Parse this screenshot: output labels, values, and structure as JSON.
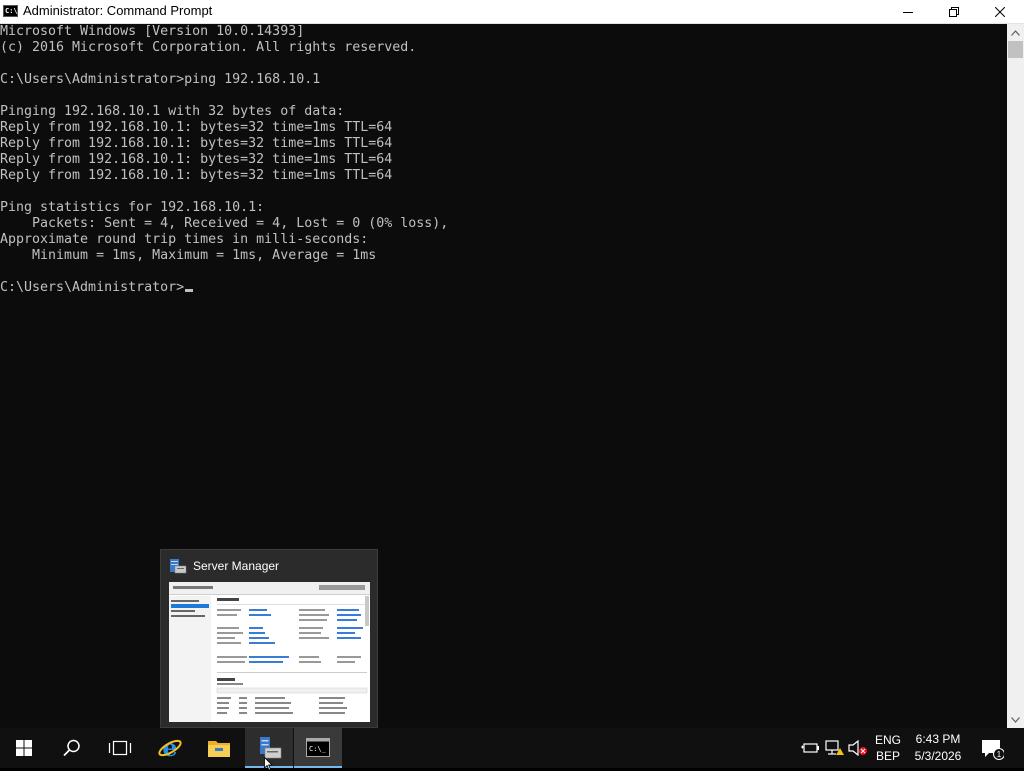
{
  "window": {
    "title": "Administrator: Command Prompt",
    "icon": "cmd-icon"
  },
  "console": {
    "lines": [
      "Microsoft Windows [Version 10.0.14393]",
      "(c) 2016 Microsoft Corporation. All rights reserved.",
      "",
      "C:\\Users\\Administrator>ping 192.168.10.1",
      "",
      "Pinging 192.168.10.1 with 32 bytes of data:",
      "Reply from 192.168.10.1: bytes=32 time=1ms TTL=64",
      "Reply from 192.168.10.1: bytes=32 time=1ms TTL=64",
      "Reply from 192.168.10.1: bytes=32 time=1ms TTL=64",
      "Reply from 192.168.10.1: bytes=32 time=1ms TTL=64",
      "",
      "Ping statistics for 192.168.10.1:",
      "    Packets: Sent = 4, Received = 4, Lost = 0 (0% loss),",
      "Approximate round trip times in milli-seconds:",
      "    Minimum = 1ms, Maximum = 1ms, Average = 1ms",
      "",
      "C:\\Users\\Administrator>"
    ]
  },
  "preview": {
    "title": "Server Manager"
  },
  "taskbar": {
    "items": [
      "start-icon",
      "search-icon",
      "task-view-icon",
      "internet-explorer-icon",
      "file-explorer-icon",
      "server-manager-icon",
      "command-prompt-icon"
    ]
  },
  "tray": {
    "lang_top": "ENG",
    "lang_bottom": "BEP",
    "time": "6:43 PM",
    "date": "5/3/2026",
    "notification_count": "1"
  },
  "colors": {
    "console_bg": "#0c0c0c",
    "console_fg": "#c0c0c0",
    "taskbar_bg": "#101010",
    "accent": "#76b9ed"
  }
}
